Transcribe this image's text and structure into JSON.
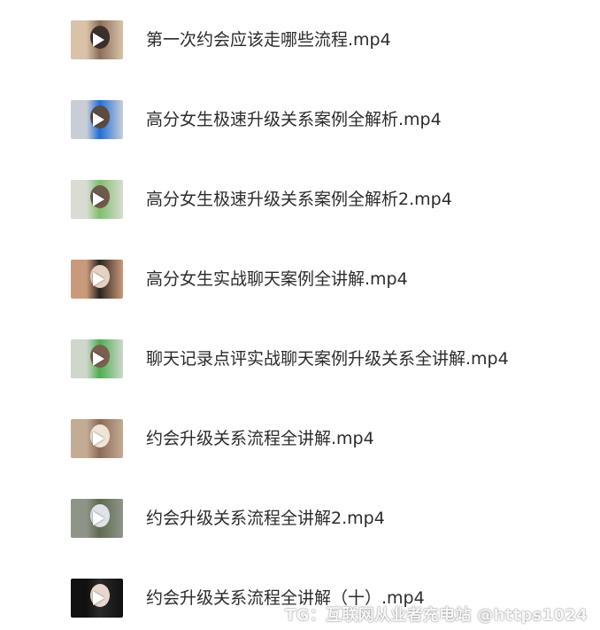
{
  "files": [
    {
      "name": "第一次约会应该走哪些流程.mp4",
      "thumb_colors": [
        "#d9c2a8",
        "#8a6e5a",
        "#3b2f2a"
      ]
    },
    {
      "name": "高分女生极速升级关系案例全解析.mp4",
      "thumb_colors": [
        "#c9ced6",
        "#1e6fd9",
        "#5b4a3e"
      ]
    },
    {
      "name": "高分女生极速升级关系案例全解析2.mp4",
      "thumb_colors": [
        "#d8dcd2",
        "#7fbf6a",
        "#6e5a4c"
      ]
    },
    {
      "name": "高分女生实战聊天案例全讲解.mp4",
      "thumb_colors": [
        "#c99a7a",
        "#2d2420",
        "#e3d3c3"
      ]
    },
    {
      "name": "聊天记录点评实战聊天案例升级关系全讲解.mp4",
      "thumb_colors": [
        "#cfd6cc",
        "#4caf50",
        "#7a5f4e"
      ]
    },
    {
      "name": "约会升级关系流程全讲解.mp4",
      "thumb_colors": [
        "#c4ab94",
        "#8c6b57",
        "#efe4d8"
      ]
    },
    {
      "name": "约会升级关系流程全讲解2.mp4",
      "thumb_colors": [
        "#8e9488",
        "#5e6b52",
        "#dfe3e8"
      ]
    },
    {
      "name": "约会升级关系流程全讲解（十）.mp4",
      "thumb_colors": [
        "#111111",
        "#2a2a2a",
        "#e8d6cf"
      ]
    }
  ],
  "watermark": "TG：互联网从业者充电站 @https1024"
}
